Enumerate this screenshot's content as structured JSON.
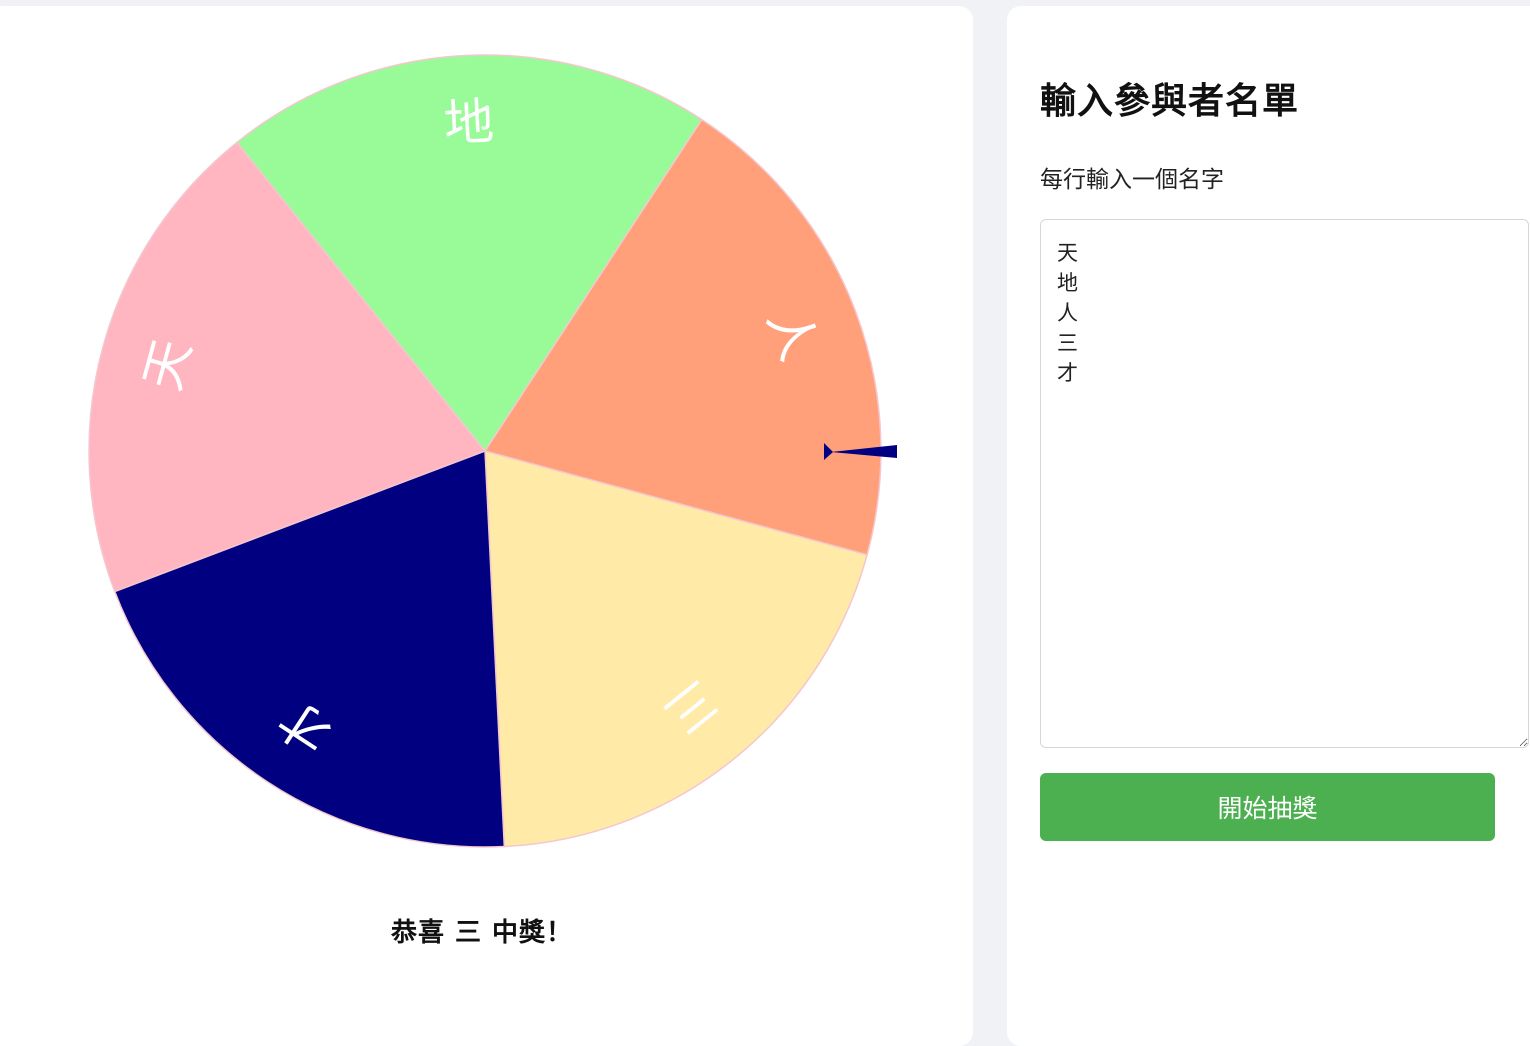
{
  "wheel": {
    "segments": [
      {
        "label": "天",
        "color": "#ffb6c1"
      },
      {
        "label": "地",
        "color": "#98fb98"
      },
      {
        "label": "人",
        "color": "#ffa07a"
      },
      {
        "label": "三",
        "color": "#ffeaa7"
      },
      {
        "label": "才",
        "color": "#000080"
      }
    ],
    "pointer_color": "#000080",
    "text_color": "#ffffff"
  },
  "result": {
    "text": "恭喜 三 中獎！"
  },
  "panel": {
    "title": "輸入參與者名單",
    "hint": "每行輸入一個名字",
    "names_value": "天\n地\n人\n三\n才",
    "start_button_label": "開始抽獎",
    "button_color": "#4caf50"
  }
}
